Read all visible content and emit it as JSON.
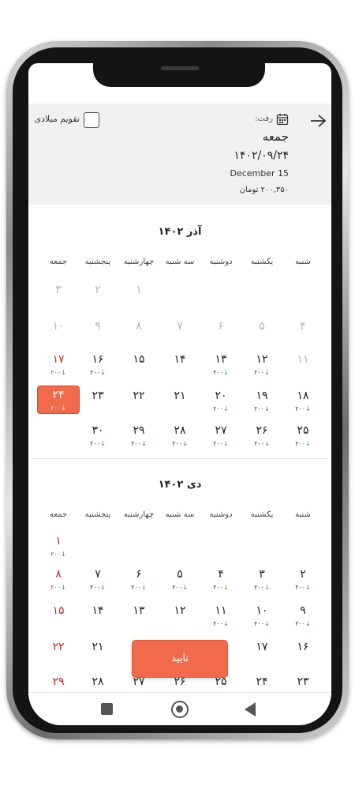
{
  "header": {
    "back_icon": "arrow-right-icon",
    "gregorian_toggle_label": "تقویم میلادی",
    "depart_label": "رفت:",
    "day_name": "جمعه",
    "date_persian": "۱۴۰۲/۰۹/۲۴",
    "date_gregorian": "December 15",
    "price": "۲۰۰,۳۵۰ تومان"
  },
  "weekdays": [
    "شنبه",
    "یکشنبه",
    "دوشنبه",
    "سه شنبه",
    "چهارشنبه",
    "پنجشنبه",
    "جمعه"
  ],
  "months": [
    {
      "title": "آذر ۱۴۰۲",
      "rows": [
        [
          {
            "col": 4,
            "day": "۱",
            "state": "disabled"
          },
          {
            "col": 5,
            "day": "۲",
            "state": "disabled"
          },
          {
            "col": 6,
            "day": "۳",
            "state": "disabled"
          }
        ],
        [
          {
            "col": 0,
            "day": "۴",
            "state": "disabled"
          },
          {
            "col": 1,
            "day": "۵",
            "state": "disabled"
          },
          {
            "col": 2,
            "day": "۶",
            "state": "disabled"
          },
          {
            "col": 3,
            "day": "۷",
            "state": "disabled"
          },
          {
            "col": 4,
            "day": "۸",
            "state": "disabled"
          },
          {
            "col": 5,
            "day": "۹",
            "state": "disabled"
          },
          {
            "col": 6,
            "day": "۱۰",
            "state": "disabled"
          }
        ],
        [
          {
            "col": 0,
            "day": "۱۱",
            "state": "disabled"
          },
          {
            "col": 1,
            "day": "۱۲",
            "price": "۲۰۰"
          },
          {
            "col": 2,
            "day": "۱۳",
            "price": "۲۰۰"
          },
          {
            "col": 3,
            "day": "۱۴"
          },
          {
            "col": 4,
            "day": "۱۵"
          },
          {
            "col": 5,
            "day": "۱۶",
            "price": "۲۰۰"
          },
          {
            "col": 6,
            "day": "۱۷",
            "price": "۲۰۰",
            "state": "holiday"
          }
        ],
        [
          {
            "col": 0,
            "day": "۱۸",
            "price": "۲۰۰"
          },
          {
            "col": 1,
            "day": "۱۹",
            "price": "۲۰۰"
          },
          {
            "col": 2,
            "day": "۲۰",
            "price": "۲۰۰"
          },
          {
            "col": 3,
            "day": "۲۱"
          },
          {
            "col": 4,
            "day": "۲۲"
          },
          {
            "col": 5,
            "day": "۲۳"
          },
          {
            "col": 6,
            "day": "۲۴",
            "price": "۲۰۰",
            "state": "selected"
          }
        ],
        [
          {
            "col": 0,
            "day": "۲۵",
            "price": "۲۰۰"
          },
          {
            "col": 1,
            "day": "۲۶",
            "price": "۲۰۰"
          },
          {
            "col": 2,
            "day": "۲۷",
            "price": "۲۰۰"
          },
          {
            "col": 3,
            "day": "۲۸",
            "price": "۲۰۰"
          },
          {
            "col": 4,
            "day": "۲۹",
            "price": "۲۰۰"
          },
          {
            "col": 5,
            "day": "۳۰",
            "price": "۲۰۰"
          }
        ]
      ]
    },
    {
      "title": "دی ۱۴۰۲",
      "rows": [
        [
          {
            "col": 6,
            "day": "۱",
            "price": "۲۰۰",
            "state": "holiday"
          }
        ],
        [
          {
            "col": 0,
            "day": "۲",
            "price": "۲۰۰"
          },
          {
            "col": 1,
            "day": "۳",
            "price": "۲۰۰"
          },
          {
            "col": 2,
            "day": "۴",
            "price": "۲۰۰"
          },
          {
            "col": 3,
            "day": "۵",
            "price": "۲۰۰"
          },
          {
            "col": 4,
            "day": "۶",
            "price": "۲۰۰"
          },
          {
            "col": 5,
            "day": "۷",
            "price": "۲۰۰"
          },
          {
            "col": 6,
            "day": "۸",
            "price": "۲۰۰",
            "state": "holiday"
          }
        ],
        [
          {
            "col": 0,
            "day": "۹",
            "price": "۲۰۰"
          },
          {
            "col": 1,
            "day": "۱۰",
            "price": "۲۰۰"
          },
          {
            "col": 2,
            "day": "۱۱",
            "price": "۲۰۰"
          },
          {
            "col": 3,
            "day": "۱۲"
          },
          {
            "col": 4,
            "day": "۱۳"
          },
          {
            "col": 5,
            "day": "۱۴"
          },
          {
            "col": 6,
            "day": "۱۵",
            "state": "holiday"
          }
        ],
        [
          {
            "col": 0,
            "day": "۱۶"
          },
          {
            "col": 1,
            "day": "۱۷"
          },
          {
            "col": 5,
            "day": "۲۱"
          },
          {
            "col": 6,
            "day": "۲۲",
            "state": "holiday"
          }
        ],
        [
          {
            "col": 0,
            "day": "۲۳"
          },
          {
            "col": 1,
            "day": "۲۴"
          },
          {
            "col": 2,
            "day": "۲۵"
          },
          {
            "col": 3,
            "day": "۲۶"
          },
          {
            "col": 4,
            "day": "۲۷"
          },
          {
            "col": 5,
            "day": "۲۸"
          },
          {
            "col": 6,
            "day": "۲۹",
            "state": "holiday"
          }
        ]
      ]
    }
  ],
  "price_arrow": "↓",
  "confirm_label": "تایید",
  "colors": {
    "accent": "#f06a4b",
    "holiday": "#c62828",
    "price_arrow": "#2e9b3a",
    "header_bg": "#f1f1f1"
  },
  "navbar": {
    "recents_icon": "square-icon",
    "home_icon": "circle-home-icon",
    "back_icon": "triangle-back-icon"
  }
}
